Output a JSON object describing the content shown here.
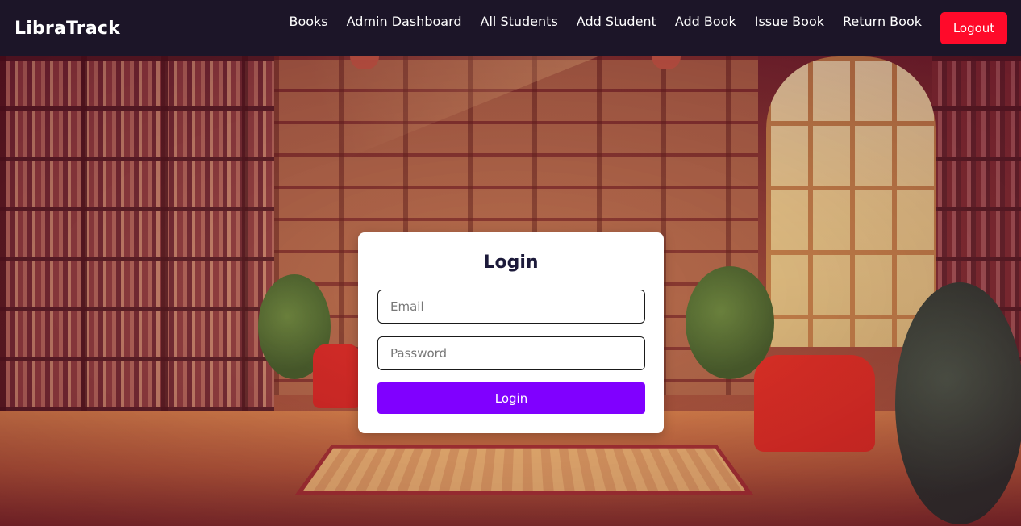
{
  "brand": {
    "name": "LibraTrack"
  },
  "nav": {
    "links": [
      {
        "label": "Books"
      },
      {
        "label": "Admin Dashboard"
      },
      {
        "label": "All Students"
      },
      {
        "label": "Add Student"
      },
      {
        "label": "Add Book"
      },
      {
        "label": "Issue Book"
      },
      {
        "label": "Return Book"
      }
    ],
    "logout_label": "Logout"
  },
  "login": {
    "title": "Login",
    "email_placeholder": "Email",
    "email_value": "",
    "password_placeholder": "Password",
    "password_value": "",
    "submit_label": "Login"
  },
  "colors": {
    "navbar_bg": "#1c1528",
    "logout_bg": "#ff0a2a",
    "submit_bg": "#8000ff",
    "title_color": "#1c1a3a"
  }
}
